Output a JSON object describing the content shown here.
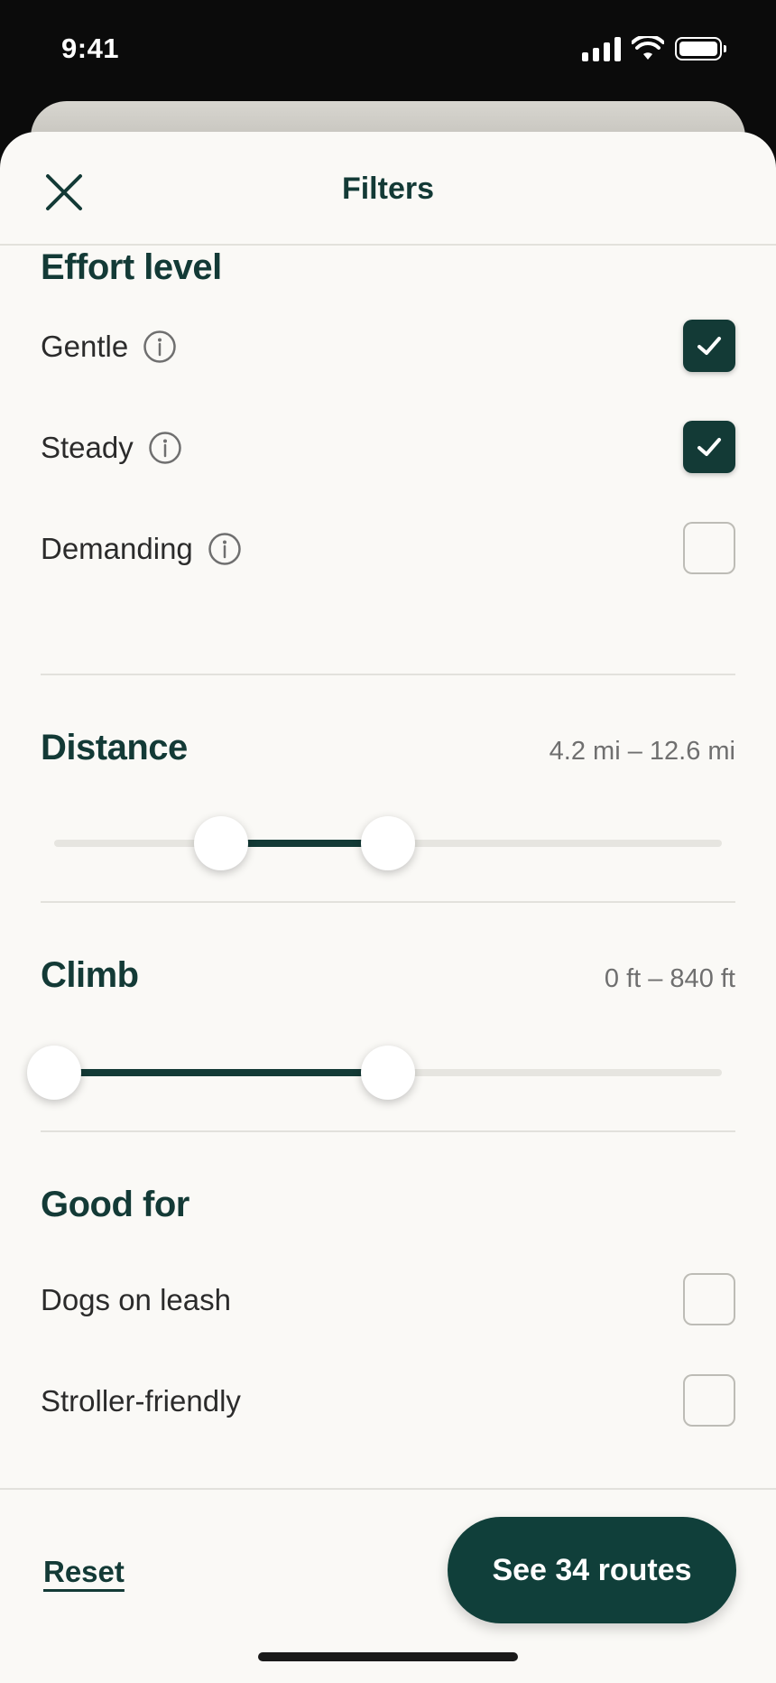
{
  "status_bar": {
    "time": "9:41"
  },
  "header": {
    "title": "Filters"
  },
  "effort": {
    "title": "Effort level",
    "options": [
      {
        "label": "Gentle",
        "checked": true
      },
      {
        "label": "Steady",
        "checked": true
      },
      {
        "label": "Demanding",
        "checked": false
      }
    ]
  },
  "distance": {
    "title": "Distance",
    "range_text": "4.2 mi – 12.6 mi",
    "min_fraction": 0.25,
    "max_fraction": 0.5
  },
  "climb": {
    "title": "Climb",
    "range_text": "0 ft – 840 ft",
    "min_fraction": 0.0,
    "max_fraction": 0.5
  },
  "good_for": {
    "title": "Good for",
    "options": [
      {
        "label": "Dogs on leash",
        "checked": false
      },
      {
        "label": "Stroller-friendly",
        "checked": false
      }
    ]
  },
  "footer": {
    "reset_label": "Reset",
    "primary_label": "See 34 routes"
  },
  "colors": {
    "accent": "#133a36",
    "background": "#faf9f6"
  },
  "icons": {
    "close": "close-icon",
    "info": "info-icon",
    "check": "check-icon"
  }
}
